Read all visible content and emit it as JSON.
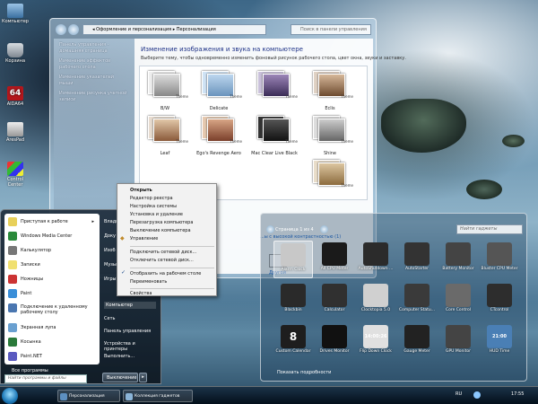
{
  "desktop": {
    "icons": [
      {
        "label": "Компьютер",
        "icon": "computer-icon"
      },
      {
        "label": "Корзина",
        "icon": "recycle-bin-icon"
      },
      {
        "label": "AIDA64",
        "icon": "aida64-icon",
        "glyph": "64"
      },
      {
        "label": "AresPad",
        "icon": "arespad-icon"
      },
      {
        "label": "Control Center",
        "icon": "control-center-icon"
      }
    ]
  },
  "explorer": {
    "address": "◂ Оформление и персонализация ▸ Персонализация",
    "search_placeholder": "Поиск в панели управления",
    "left_links": [
      "Панель управления - домашняя страница",
      "Изменение эффектов рабочего стола",
      "Изменение указателей мыши",
      "Изменение рисунка учетной записи"
    ],
    "heading": "Изменение изображения и звука на компьютере",
    "description": "Выберите тему, чтобы одновременно изменить фоновый рисунок рабочего стола, цвет окна, звуки и заставку.",
    "themes": [
      {
        "name": "B/W",
        "tag": "Theme"
      },
      {
        "name": "Delicate",
        "tag": "Theme"
      },
      {
        "name": "",
        "tag": "Theme"
      },
      {
        "name": "Eclis",
        "tag": "Theme"
      },
      {
        "name": "Leaf",
        "tag": "Theme"
      },
      {
        "name": "Ego's Revenge Aero",
        "tag": "Theme"
      },
      {
        "name": "Mac Clear Live Black",
        "tag": "Theme"
      },
      {
        "name": "Shine",
        "tag": "Theme"
      },
      {
        "name": "",
        "tag": "Theme"
      }
    ],
    "contrast_link": "...ы с высокой контрастностью (1)",
    "other_label": "Другой"
  },
  "start_menu": {
    "programs": [
      {
        "label": "Приступая к работе",
        "icon": "getting-started-icon",
        "arrow": "▸"
      },
      {
        "label": "Windows Media Center",
        "icon": "media-center-icon"
      },
      {
        "label": "Калькулятор",
        "icon": "calculator-icon"
      },
      {
        "label": "Записки",
        "icon": "sticky-notes-icon"
      },
      {
        "label": "Ножницы",
        "icon": "snipping-tool-icon"
      },
      {
        "label": "Paint",
        "icon": "paint-icon"
      },
      {
        "label": "Подключение к удаленному рабочему столу",
        "icon": "remote-desktop-icon"
      },
      {
        "label": "Экранная лупа",
        "icon": "magnifier-icon"
      },
      {
        "label": "Косынка",
        "icon": "solitaire-icon"
      },
      {
        "label": "Paint.NET",
        "icon": "paintnet-icon"
      }
    ],
    "all_programs": "Все программы",
    "search_placeholder": "Найти программы и файлы",
    "right_items": [
      "Влади",
      "Доку",
      "Изоб",
      "Музыка",
      "Игры",
      "Компьютер",
      "Сеть",
      "Панель управления",
      "Устройства и принтеры",
      "Выполнить..."
    ],
    "shutdown_label": "Выключение",
    "shutdown_arrow": "▸"
  },
  "context_menu": {
    "group1": [
      "Открыть",
      "Редактор реестра",
      "Настройка системы",
      "Установка и удаление",
      "Перезагрузка компьютера",
      "Выключение компьютера",
      "Управление"
    ],
    "group2": [
      "Подключить сетевой диск...",
      "Отключить сетевой диск..."
    ],
    "group3": [
      "Отобразить на рабочем столе",
      "Переименовать"
    ],
    "group4": [
      "Свойства"
    ],
    "check_mark": "✓"
  },
  "gadgets": {
    "page_label": "Страница 1 из 4",
    "search_placeholder": "Найти гаджеты",
    "tiles": [
      {
        "label": "Alarm Clock",
        "color": "#c8c8c8"
      },
      {
        "label": "All CPU Meter",
        "color": "#1a1a1a"
      },
      {
        "label": "AutoShutdown ...",
        "color": "#2b2b2b"
      },
      {
        "label": "AutoStarter",
        "color": "#333333"
      },
      {
        "label": "Battery Monitor",
        "color": "#444444"
      },
      {
        "label": "Bluster CPU Meter",
        "color": "#555555"
      },
      {
        "label": "Blackbin",
        "color": "#2a2a2a"
      },
      {
        "label": "Calculator",
        "color": "#303030"
      },
      {
        "label": "Clocktopia 5.0",
        "color": "#d0d0d0"
      },
      {
        "label": "Computer Statu...",
        "color": "#3a3a3a"
      },
      {
        "label": "Core Control",
        "color": "#6a6a6a"
      },
      {
        "label": "CTcontrol",
        "color": "#2d2d2d"
      },
      {
        "label": "Custom Calendar",
        "color": "#1e1e1e",
        "glyph": "8"
      },
      {
        "label": "Drives Monitor",
        "color": "#111111"
      },
      {
        "label": "Flip Down Clock",
        "color": "#e0e0e0",
        "glyph": "14:00:26"
      },
      {
        "label": "Gauge Meter",
        "color": "#222222"
      },
      {
        "label": "GPU Monitor",
        "color": "#444444"
      },
      {
        "label": "HUD Time",
        "color": "#4a7fb5",
        "glyph": "21:00"
      }
    ],
    "more_label": "Показать подробности"
  },
  "taskbar": {
    "buttons": [
      {
        "label": "Персонализация",
        "icon": "control-panel-icon"
      },
      {
        "label": "Коллекция гаджетов",
        "icon": "gadgets-icon"
      }
    ],
    "lang": "RU",
    "time": "17:55"
  }
}
